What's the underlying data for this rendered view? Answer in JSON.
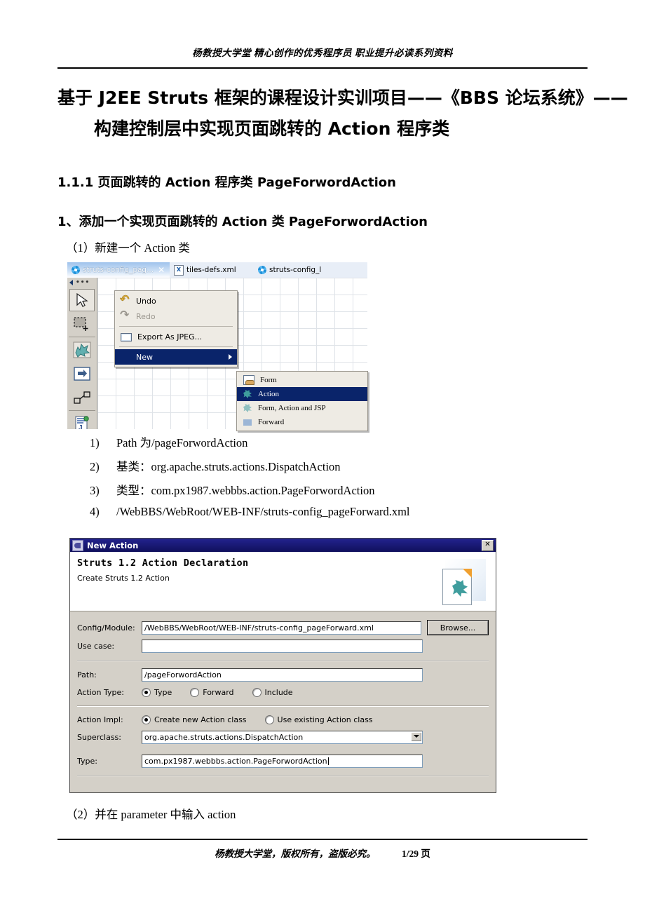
{
  "document": {
    "header_text": "杨教授大学堂 精心创作的优秀程序员 职业提升必读系列资料",
    "title_line1": "基于 J2EE Struts 框架的课程设计实训项目——《BBS 论坛系统》——",
    "title_line2": "构建控制层中实现页面跳转的 Action 程序类",
    "heading_1": "1.1.1 页面跳转的 Action 程序类 PageForwordAction",
    "heading_2": "1、添加一个实现页面跳转的 Action 类 PageForwordAction",
    "para_1": "（1）新建一个 Action 类",
    "para_2": "（2）并在 parameter 中输入 action",
    "footer_text": "杨教授大学堂，版权所有，盗版必究。",
    "footer_page": "1/29 页"
  },
  "steps": [
    {
      "marker": "1)",
      "text": "Path 为/pageForwordAction"
    },
    {
      "marker": "2)",
      "text": "基类：org.apache.struts.actions.DispatchAction"
    },
    {
      "marker": "3)",
      "text": "类型：com.px1987.webbbs.action.PageForwordAction"
    },
    {
      "marker": "4)",
      "text": "/WebBBS/WebRoot/WEB-INF/struts-config_pageForward.xml"
    }
  ],
  "editor": {
    "tabs": [
      {
        "label": "struts-config_pag...",
        "icon": "cog-icon",
        "active": true,
        "close": "✕"
      },
      {
        "label": "tiles-defs.xml",
        "icon": "xml-file-icon",
        "active": false
      },
      {
        "label": "struts-config_l",
        "icon": "cog-icon",
        "active": false
      }
    ],
    "palette": {
      "collapse_dots": "•••",
      "tools": [
        "select-tool",
        "marquee-tool",
        "action-tool",
        "forward-tool",
        "link-tool",
        "jsp-tool"
      ]
    },
    "context_menu": [
      {
        "label": "Undo",
        "accel": "U",
        "icon": "undo-icon",
        "state": "enabled"
      },
      {
        "label": "Redo",
        "accel": "R",
        "icon": "redo-icon",
        "state": "disabled"
      },
      {
        "label": "Export As JPEG...",
        "icon": "jpeg-export-icon",
        "state": "enabled"
      },
      {
        "label": "New",
        "icon": "",
        "state": "submenu",
        "has_submenu": true
      }
    ],
    "submenu": [
      {
        "label": "Form",
        "icon": "form-icon",
        "selected": false
      },
      {
        "label": "Action",
        "icon": "action-icon",
        "selected": true
      },
      {
        "label": "Form, Action and JSP",
        "icon": "form-action-jsp-icon",
        "selected": false
      },
      {
        "label": "Forward",
        "icon": "forward-icon",
        "selected": false
      }
    ]
  },
  "dialog": {
    "title": "New Action",
    "close_label": "✕",
    "banner_heading": "Struts 1.2 Action Declaration",
    "banner_subtext": "Create Struts 1.2 Action",
    "fields": {
      "config_module_label": "Config/Module:",
      "config_module_value": "/WebBBS/WebRoot/WEB-INF/struts-config_pageForward.xml",
      "browse_label": "Browse...",
      "use_case_label": "Use case:",
      "use_case_value": "",
      "path_label": "Path:",
      "path_value": "/pageForwordAction",
      "action_type_label": "Action Type:",
      "action_type_options": [
        "Type",
        "Forward",
        "Include"
      ],
      "action_type_selected": "Type",
      "action_impl_label": "Action Impl:",
      "action_impl_options": [
        "Create new Action class",
        "Use existing Action class"
      ],
      "action_impl_selected": "Create new Action class",
      "superclass_label": "Superclass:",
      "superclass_value": "org.apache.struts.actions.DispatchAction",
      "type_label": "Type:",
      "type_value": "com.px1987.webbbs.action.PageForwordAction"
    }
  },
  "colors": {
    "title_bar": "#10105c",
    "menu_highlight": "#0a246a",
    "dialog_face": "#d4d0c8",
    "tab_active": "#9fc3ec"
  }
}
